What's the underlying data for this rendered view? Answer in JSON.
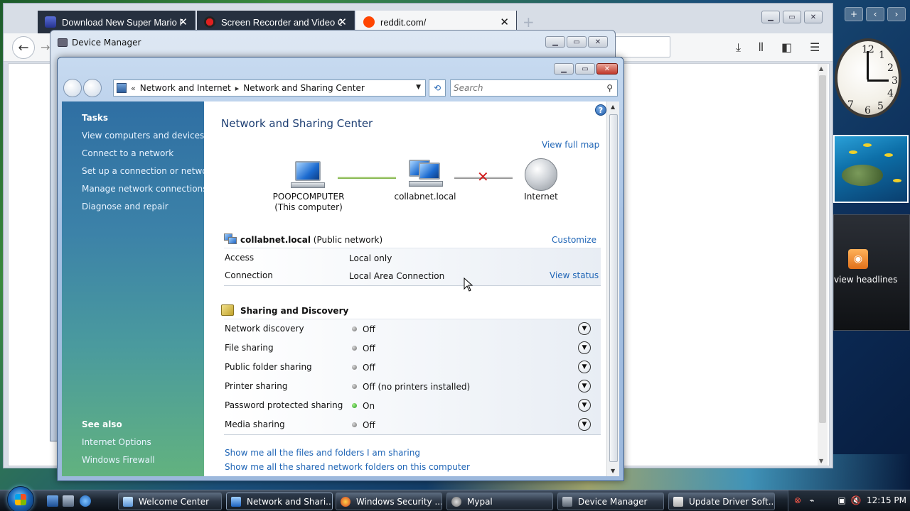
{
  "browser": {
    "tabs": [
      {
        "label": "Download New Super Mario Fo",
        "icon": "shield-icon"
      },
      {
        "label": "Screen Recorder and Video Cu",
        "icon": "record-icon"
      },
      {
        "label": "reddit.com/",
        "icon": "reddit-icon"
      }
    ],
    "new_tab": "+"
  },
  "devmgr": {
    "title": "Device Manager"
  },
  "nsc": {
    "breadcrumb": [
      "Network and Internet",
      "Network and Sharing Center"
    ],
    "search_placeholder": "Search",
    "sidebar": {
      "tasks_header": "Tasks",
      "tasks": [
        "View computers and devices",
        "Connect to a network",
        "Set up a connection or network",
        "Manage network connections",
        "Diagnose and repair"
      ],
      "see_also_header": "See also",
      "see_also": [
        "Internet Options",
        "Windows Firewall"
      ]
    },
    "title": "Network and Sharing Center",
    "view_full_map": "View full map",
    "map": {
      "computer_name": "POOPCOMPUTER",
      "computer_sub": "(This computer)",
      "network_name": "collabnet.local",
      "internet": "Internet"
    },
    "network": {
      "name": "collabnet.local",
      "type": "(Public network)",
      "customize": "Customize",
      "rows": [
        {
          "label": "Access",
          "value": "Local only",
          "action": ""
        },
        {
          "label": "Connection",
          "value": "Local Area Connection",
          "action": "View status"
        }
      ]
    },
    "sharing": {
      "header": "Sharing and Discovery",
      "rows": [
        {
          "label": "Network discovery",
          "status": "Off",
          "on": false
        },
        {
          "label": "File sharing",
          "status": "Off",
          "on": false
        },
        {
          "label": "Public folder sharing",
          "status": "Off",
          "on": false
        },
        {
          "label": "Printer sharing",
          "status": "Off (no printers installed)",
          "on": false
        },
        {
          "label": "Password protected sharing",
          "status": "On",
          "on": true
        },
        {
          "label": "Media sharing",
          "status": "Off",
          "on": false
        }
      ]
    },
    "bottom_links": [
      "Show me all the files and folders I am sharing",
      "Show me all the shared network folders on this computer"
    ]
  },
  "gadgets": {
    "clock_numbers": [
      "12",
      "1",
      "2",
      "3",
      "4",
      "5",
      "6",
      "7"
    ],
    "feed_label": "view headlines"
  },
  "taskbar": {
    "buttons": [
      {
        "label": "Welcome Center",
        "active": false
      },
      {
        "label": "Network and Shari...",
        "active": true
      },
      {
        "label": "Windows Security ...",
        "active": false
      },
      {
        "label": "Mypal",
        "active": false
      },
      {
        "label": "Device Manager",
        "active": false
      },
      {
        "label": "Update Driver Soft...",
        "active": false
      }
    ],
    "time": "12:15 PM"
  }
}
